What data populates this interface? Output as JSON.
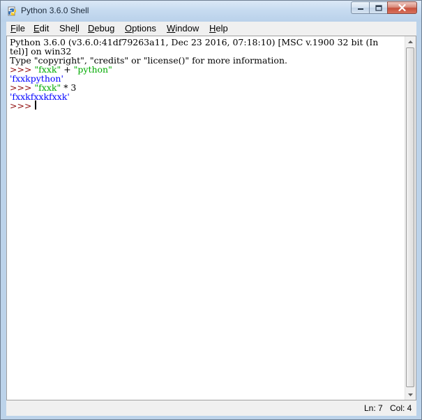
{
  "window": {
    "title": "Python 3.6.0 Shell"
  },
  "menu": [
    {
      "label_ul": "F",
      "label_rest": "ile"
    },
    {
      "label_ul": "E",
      "label_rest": "dit"
    },
    {
      "label_pre": "She",
      "label_ul": "l",
      "label_rest": "l"
    },
    {
      "label_ul": "D",
      "label_rest": "ebug"
    },
    {
      "label_ul": "O",
      "label_rest": "ptions"
    },
    {
      "label_ul": "W",
      "label_rest": "indow"
    },
    {
      "label_ul": "H",
      "label_rest": "elp"
    }
  ],
  "shell": {
    "banner_line1": "Python 3.6.0 (v3.6.0:41df79263a11, Dec 23 2016, 07:18:10) [MSC v.1900 32 bit (In",
    "banner_line2": "tel)] on win32",
    "banner_line3": "Type \"copyright\", \"credits\" or \"license()\" for more information.",
    "prompt": ">>> ",
    "cmd1_str1": "\"fxxk\"",
    "cmd1_op": " + ",
    "cmd1_str2": "\"python\"",
    "out1": "'fxxkpython'",
    "cmd2_str": "\"fxxk\"",
    "cmd2_op": " * 3",
    "out2": "'fxxkfxxkfxxk'"
  },
  "status": {
    "line": "Ln: 7",
    "col": "Col: 4"
  },
  "colors": {
    "prompt": "#8b0000",
    "string": "#00aa00",
    "output": "#0000ff"
  },
  "icons": {
    "app": "python-idle-icon",
    "minimize": "minimize-icon",
    "maximize": "maximize-icon",
    "close": "close-icon"
  }
}
